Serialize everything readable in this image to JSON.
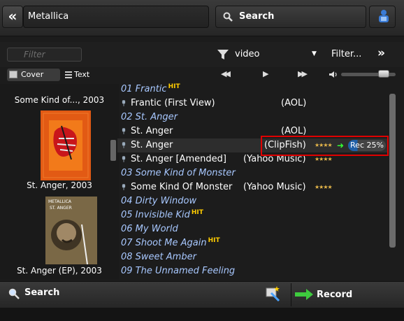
{
  "topbar": {
    "back_icon": "«",
    "query": "Metallica",
    "search_label": "Search",
    "user_icon": "user-icon"
  },
  "filter": {
    "placeholder": "Filter",
    "value": "video",
    "more_label": "Filter...",
    "forward_icon": "»"
  },
  "view": {
    "cover_label": "Cover",
    "text_label": "Text"
  },
  "player": {
    "prev_icon": "◀◀",
    "play_icon": "▶",
    "next_icon": "▶▶",
    "volume": 0.85
  },
  "covers": [
    {
      "label": "Some Kind of..., 2003"
    },
    {
      "label": "St. Anger, 2003",
      "art_text": ""
    },
    {
      "label": "St. Anger (EP), 2003",
      "art_text": "METALLICA",
      "art_sub": "ST. ANGER"
    }
  ],
  "tracklist": {
    "rows": [
      {
        "type": "album",
        "text": "01 Frantic",
        "hit": "HIT"
      },
      {
        "type": "track",
        "title": "Frantic (First View)",
        "source": "(AOL)",
        "rating": ""
      },
      {
        "type": "album",
        "text": "02 St. Anger",
        "hit": ""
      },
      {
        "type": "track",
        "title": "St. Anger",
        "source": "(AOL)",
        "rating": ""
      },
      {
        "type": "track",
        "title": "St. Anger",
        "source": "(ClipFish)",
        "rating": "★★★★",
        "selected": true
      },
      {
        "type": "track",
        "title": "St. Anger [Amended]",
        "source": "(Yahoo Music)",
        "rating": "★★★★"
      },
      {
        "type": "album",
        "text": "03 Some Kind of Monster",
        "hit": ""
      },
      {
        "type": "track",
        "title": "Some Kind Of Monster",
        "source": "(Yahoo Music)",
        "rating": "★★★★"
      },
      {
        "type": "album",
        "text": "04 Dirty Window",
        "hit": ""
      },
      {
        "type": "album",
        "text": "05 Invisible Kid",
        "hit": "HIT"
      },
      {
        "type": "album",
        "text": "06 My World",
        "hit": ""
      },
      {
        "type": "album",
        "text": "07 Shoot Me Again",
        "hit": "HIT"
      },
      {
        "type": "album",
        "text": "08 Sweet Amber",
        "hit": ""
      },
      {
        "type": "album",
        "text": "09 The Unnamed Feeling",
        "hit": ""
      }
    ],
    "rec_status": "Rec 25%",
    "rec_progress": 0.25
  },
  "bottombar": {
    "search_label": "Search",
    "record_label": "Record",
    "wand_icon": "magic-wand-icon"
  },
  "colors": {
    "album_text": "#a8c8ff",
    "hit_badge": "#ffcc00",
    "highlight_box": "#e00000",
    "record_arrow": "#33cc33"
  }
}
